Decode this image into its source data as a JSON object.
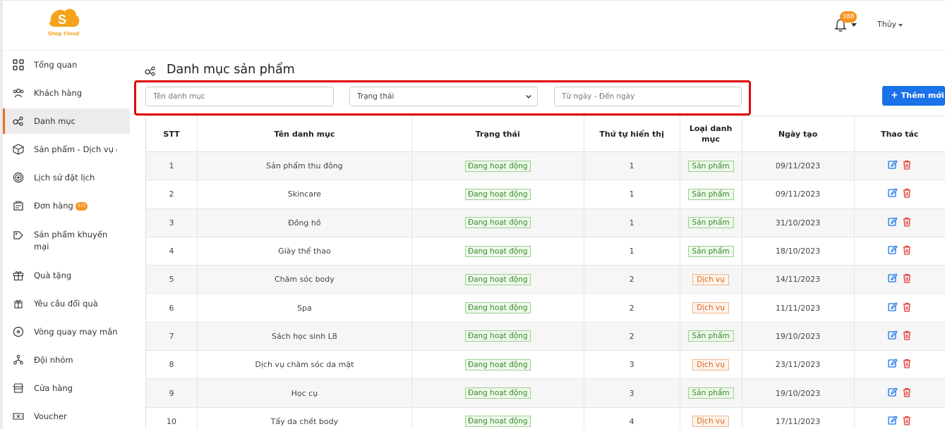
{
  "brand": {
    "logo_text": "Shop Cloud"
  },
  "header": {
    "notification_count": "388",
    "user_name": "Thủy"
  },
  "sidebar": {
    "items": [
      {
        "label": "Tổng quan",
        "icon": "grid-icon"
      },
      {
        "label": "Khách hàng",
        "icon": "users-icon"
      },
      {
        "label": "Danh mục",
        "icon": "category-icon",
        "active": true
      },
      {
        "label": "Sản phẩm - Dịch vụ",
        "icon": "box-icon",
        "chevron": "‹"
      },
      {
        "label": "Lịch sử đặt lịch",
        "icon": "target-icon"
      },
      {
        "label": "Đơn hàng",
        "icon": "order-icon",
        "badge": "375"
      },
      {
        "label": "Sản phẩm khuyến mại",
        "icon": "promo-icon"
      },
      {
        "label": "Quà tặng",
        "icon": "gift-icon"
      },
      {
        "label": "Yêu cầu đổi quà",
        "icon": "exchange-icon"
      },
      {
        "label": "Vòng quay may mắn",
        "icon": "wheel-icon"
      },
      {
        "label": "Đội nhóm",
        "icon": "team-icon"
      },
      {
        "label": "Cửa hàng",
        "icon": "store-icon"
      },
      {
        "label": "Voucher",
        "icon": "voucher-icon"
      }
    ]
  },
  "page": {
    "title": "Danh mục sản phẩm"
  },
  "filters": {
    "name_placeholder": "Tên danh mục",
    "status_value": "Trạng thái",
    "date_placeholder": "Từ ngày - Đến ngày",
    "add_button": "Thêm mới"
  },
  "table": {
    "headers": [
      "STT",
      "Tên danh mục",
      "Trạng thái",
      "Thứ tự hiển thị",
      "Loại danh mục",
      "Ngày tạo",
      "Thao tác"
    ],
    "rows": [
      {
        "stt": "1",
        "name": "Sản phẩm thu đông",
        "status": "Đang hoạt động",
        "order": "1",
        "type": "Sản phẩm",
        "kind": "product",
        "date": "09/11/2023"
      },
      {
        "stt": "2",
        "name": "Skincare",
        "status": "Đang hoạt động",
        "order": "1",
        "type": "Sản phẩm",
        "kind": "product",
        "date": "09/11/2023"
      },
      {
        "stt": "3",
        "name": "Đồng hồ",
        "status": "Đang hoạt động",
        "order": "1",
        "type": "Sản phẩm",
        "kind": "product",
        "date": "31/10/2023"
      },
      {
        "stt": "4",
        "name": "Giày thể thao",
        "status": "Đang hoạt động",
        "order": "1",
        "type": "Sản phẩm",
        "kind": "product",
        "date": "18/10/2023"
      },
      {
        "stt": "5",
        "name": "Chăm sóc body",
        "status": "Đang hoạt động",
        "order": "2",
        "type": "Dịch vụ",
        "kind": "service",
        "date": "14/11/2023"
      },
      {
        "stt": "6",
        "name": "Spa",
        "status": "Đang hoạt động",
        "order": "2",
        "type": "Dịch vụ",
        "kind": "service",
        "date": "11/11/2023"
      },
      {
        "stt": "7",
        "name": "Sách học sinh L8",
        "status": "Đang hoạt động",
        "order": "2",
        "type": "Sản phẩm",
        "kind": "product",
        "date": "19/10/2023"
      },
      {
        "stt": "8",
        "name": "Dịch vụ chăm sóc da mặt",
        "status": "Đang hoạt động",
        "order": "3",
        "type": "Dịch vụ",
        "kind": "service",
        "date": "23/11/2023"
      },
      {
        "stt": "9",
        "name": "Học cụ",
        "status": "Đang hoạt động",
        "order": "3",
        "type": "Sản phẩm",
        "kind": "product",
        "date": "19/10/2023"
      },
      {
        "stt": "10",
        "name": "Tẩy da chết body",
        "status": "Đang hoạt động",
        "order": "4",
        "type": "Dịch vụ",
        "kind": "service",
        "date": "17/11/2023"
      }
    ]
  },
  "colors": {
    "accent": "#1a73e8",
    "brand": "#f7931e",
    "active_border": "#e56c28",
    "highlight": "#e00000",
    "delete": "#e53935"
  }
}
